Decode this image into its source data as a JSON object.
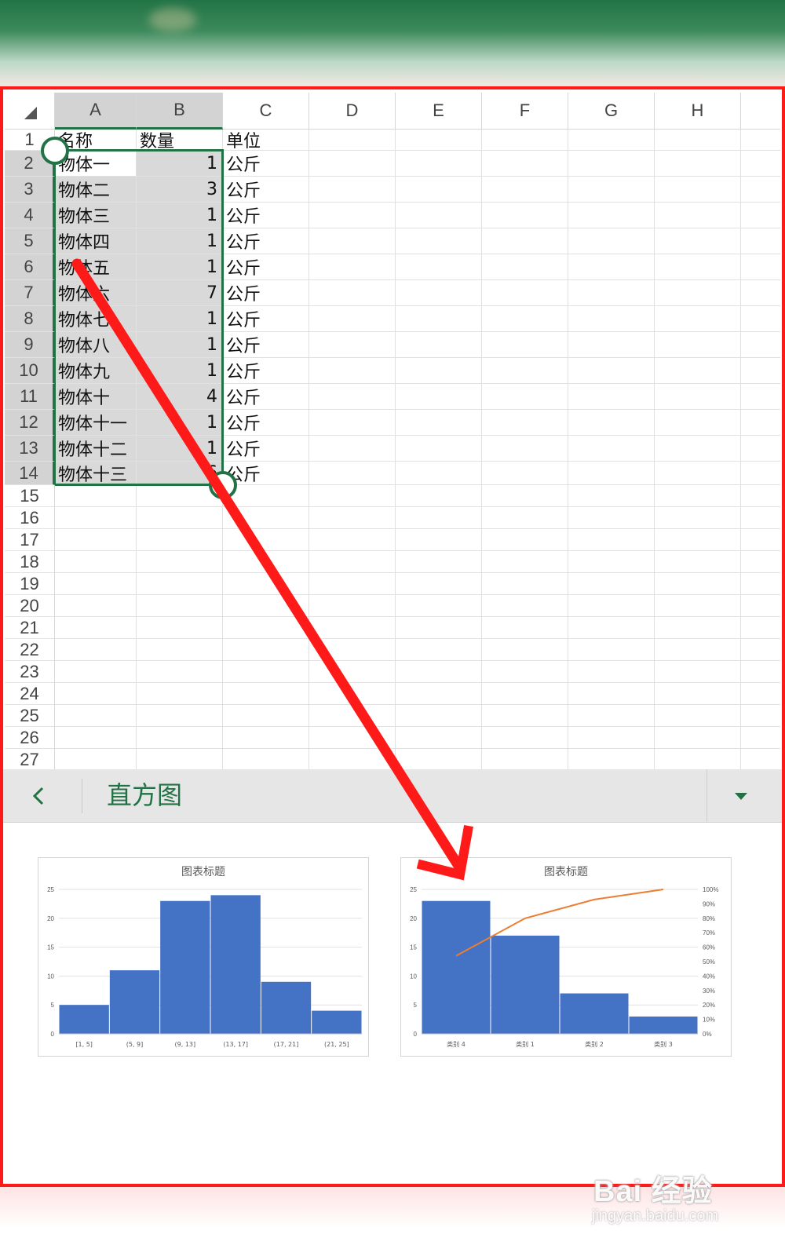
{
  "sheet": {
    "columns": [
      "A",
      "B",
      "C",
      "D",
      "E",
      "F",
      "G",
      "H"
    ],
    "row_numbers": [
      "1",
      "2",
      "3",
      "4",
      "5",
      "6",
      "7",
      "8",
      "9",
      "10",
      "11",
      "12",
      "13",
      "14",
      "15",
      "16",
      "17",
      "18",
      "19",
      "20",
      "21",
      "22",
      "23",
      "24",
      "25",
      "26",
      "27"
    ],
    "header_row": {
      "a": "名称",
      "b": "数量",
      "c": "单位"
    },
    "rows": [
      {
        "a": "物体一",
        "b": "1",
        "c": "公斤"
      },
      {
        "a": "物体二",
        "b": "3",
        "c": "公斤"
      },
      {
        "a": "物体三",
        "b": "1",
        "c": "公斤"
      },
      {
        "a": "物体四",
        "b": "1",
        "c": "公斤"
      },
      {
        "a": "物体五",
        "b": "1",
        "c": "公斤"
      },
      {
        "a": "物体六",
        "b": "7",
        "c": "公斤"
      },
      {
        "a": "物体七",
        "b": "1",
        "c": "公斤"
      },
      {
        "a": "物体八",
        "b": "1",
        "c": "公斤"
      },
      {
        "a": "物体九",
        "b": "1",
        "c": "公斤"
      },
      {
        "a": "物体十",
        "b": "4",
        "c": "公斤"
      },
      {
        "a": "物体十一",
        "b": "1",
        "c": "公斤"
      },
      {
        "a": "物体十二",
        "b": "1",
        "c": "公斤"
      },
      {
        "a": "物体十三",
        "b": "6",
        "c": "公斤"
      }
    ]
  },
  "panel": {
    "title": "直方图"
  },
  "colors": {
    "accent": "#217346",
    "bar": "#4472c4",
    "line": "#ed7d31",
    "annotation": "#ff1a1a"
  },
  "icons": {
    "back": "chevron-left-icon",
    "dropdown": "caret-down-icon",
    "select_all": "select-all-triangle-icon"
  },
  "chart_data": [
    {
      "type": "bar",
      "title": "图表标题",
      "categories": [
        "[1, 5]",
        "(5, 9]",
        "(9, 13]",
        "(13, 17]",
        "(17, 21]",
        "(21, 25]"
      ],
      "values": [
        5,
        11,
        23,
        24,
        9,
        4
      ],
      "ylim": [
        0,
        25
      ],
      "yticks": [
        "0",
        "5",
        "10",
        "15",
        "20",
        "25"
      ],
      "grid": true
    },
    {
      "type": "bar",
      "title": "图表标题",
      "categories": [
        "类别 4",
        "类别 1",
        "类别 2",
        "类别 3"
      ],
      "values": [
        23,
        17,
        7,
        3
      ],
      "line_values": [
        0.54,
        0.8,
        0.93,
        1.0
      ],
      "ylim": [
        0,
        25
      ],
      "yticks": [
        "0",
        "5",
        "10",
        "15",
        "20",
        "25"
      ],
      "y2ticks": [
        "0%",
        "10%",
        "20%",
        "30%",
        "40%",
        "50%",
        "60%",
        "70%",
        "80%",
        "90%",
        "100%"
      ],
      "grid": true
    }
  ],
  "watermark": {
    "logo": "Bai 经验",
    "url": "jingyan.baidu.com"
  }
}
